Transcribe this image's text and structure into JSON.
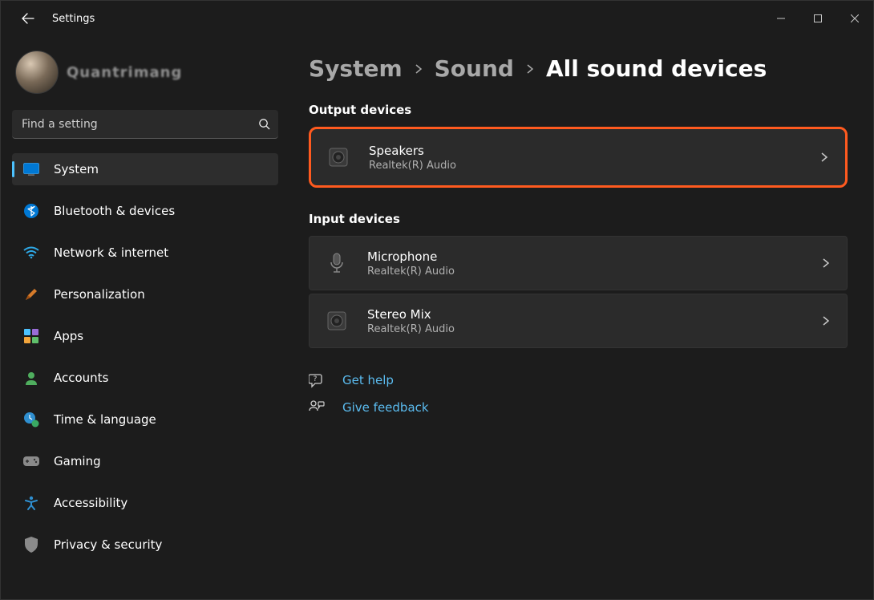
{
  "app": {
    "title": "Settings"
  },
  "profile": {
    "watermark": "Quantrimang"
  },
  "search": {
    "placeholder": "Find a setting"
  },
  "nav": {
    "items": [
      {
        "label": "System"
      },
      {
        "label": "Bluetooth & devices"
      },
      {
        "label": "Network & internet"
      },
      {
        "label": "Personalization"
      },
      {
        "label": "Apps"
      },
      {
        "label": "Accounts"
      },
      {
        "label": "Time & language"
      },
      {
        "label": "Gaming"
      },
      {
        "label": "Accessibility"
      },
      {
        "label": "Privacy & security"
      }
    ]
  },
  "breadcrumbs": {
    "items": [
      {
        "label": "System"
      },
      {
        "label": "Sound"
      },
      {
        "label": "All sound devices"
      }
    ]
  },
  "sections": {
    "output": {
      "heading": "Output devices",
      "devices": [
        {
          "name": "Speakers",
          "provider": "Realtek(R) Audio"
        }
      ]
    },
    "input": {
      "heading": "Input devices",
      "devices": [
        {
          "name": "Microphone",
          "provider": "Realtek(R) Audio"
        },
        {
          "name": "Stereo Mix",
          "provider": "Realtek(R) Audio"
        }
      ]
    }
  },
  "help": {
    "get_help": "Get help",
    "give_feedback": "Give feedback"
  },
  "colors": {
    "accent": "#4cc2ff",
    "link": "#5bbcf0",
    "highlight_border": "#ff5a1f"
  }
}
